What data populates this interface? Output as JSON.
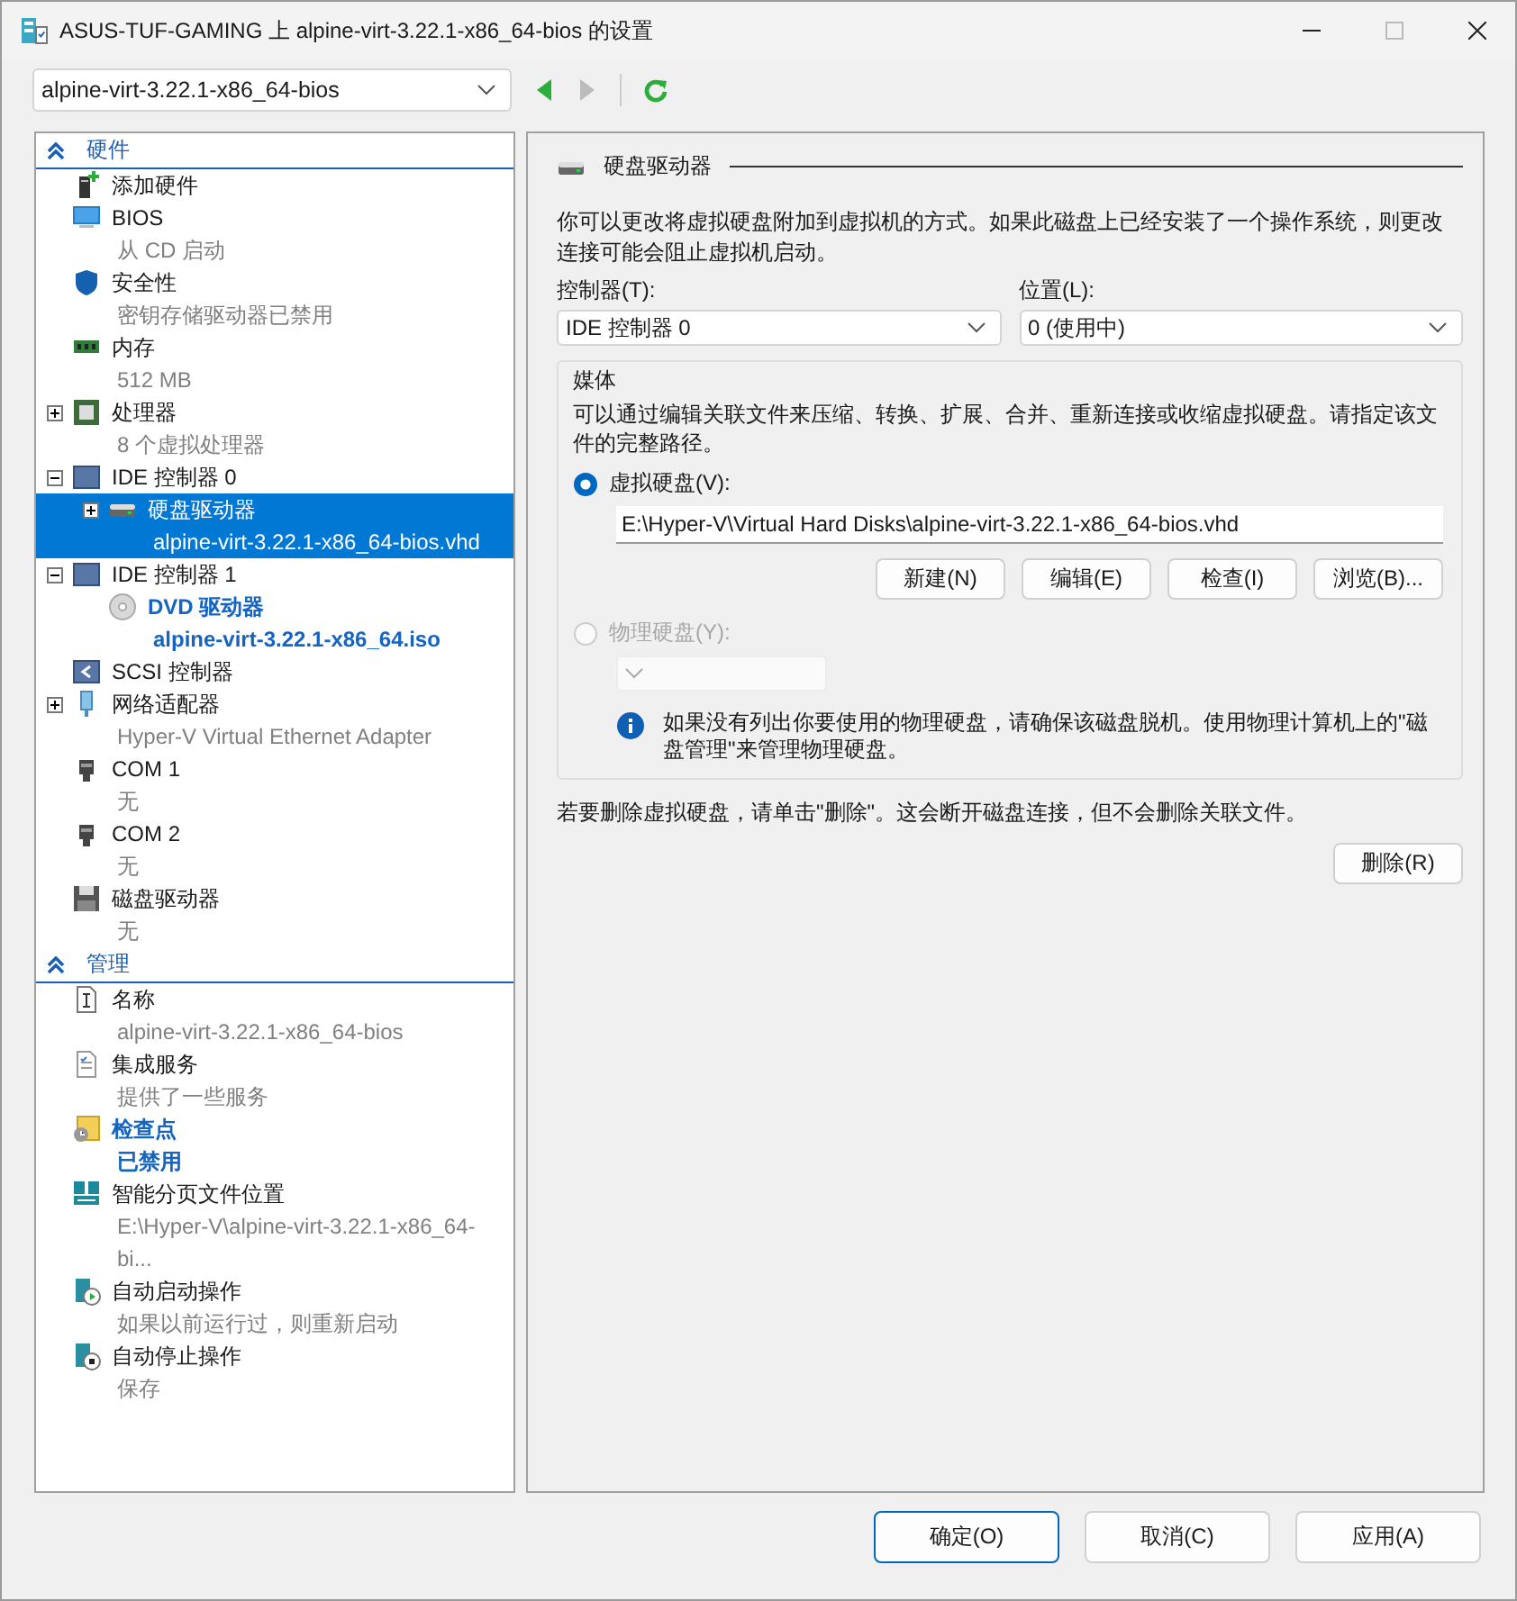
{
  "window": {
    "title": "ASUS-TUF-GAMING 上 alpine-virt-3.22.1-x86_64-bios 的设置"
  },
  "toolbar": {
    "vm_select": "alpine-virt-3.22.1-x86_64-bios",
    "back": {
      "disabled": false
    },
    "forward": {
      "disabled": true
    }
  },
  "sidebar": {
    "sections": [
      {
        "title": "硬件",
        "expanded": true,
        "items": [
          {
            "kind": "add",
            "title": "添加硬件",
            "selected": false,
            "emphasized": false
          },
          {
            "kind": "bios",
            "title": "BIOS",
            "subtitle": "从 CD 启动",
            "selected": false,
            "emphasized": false
          },
          {
            "kind": "security",
            "title": "安全性",
            "subtitle": "密钥存储驱动器已禁用",
            "selected": false,
            "emphasized": false
          },
          {
            "kind": "memory",
            "title": "内存",
            "subtitle": "512 MB",
            "selected": false,
            "emphasized": false
          },
          {
            "kind": "processor",
            "title": "处理器",
            "subtitle": "8 个虚拟处理器",
            "selected": false,
            "emphasized": false,
            "expanded": false
          },
          {
            "kind": "ide",
            "title": "IDE 控制器 0",
            "selected": false,
            "emphasized": false,
            "expanded": true,
            "children": [
              {
                "kind": "disk",
                "title": "硬盘驱动器",
                "subtitle": "alpine-virt-3.22.1-x86_64-bios.vhd",
                "selected": true,
                "emphasized": false,
                "expanded": false
              }
            ]
          },
          {
            "kind": "ide",
            "title": "IDE 控制器 1",
            "selected": false,
            "emphasized": false,
            "expanded": true,
            "children": [
              {
                "kind": "dvd",
                "title": "DVD 驱动器",
                "subtitle": "alpine-virt-3.22.1-x86_64.iso",
                "selected": false,
                "emphasized": true
              }
            ]
          },
          {
            "kind": "scsi",
            "title": "SCSI 控制器",
            "selected": false,
            "emphasized": false
          },
          {
            "kind": "network",
            "title": "网络适配器",
            "subtitle": "Hyper-V Virtual Ethernet Adapter",
            "selected": false,
            "emphasized": false,
            "expanded": false
          },
          {
            "kind": "com",
            "title": "COM 1",
            "subtitle": "无",
            "selected": false,
            "emphasized": false
          },
          {
            "kind": "com",
            "title": "COM 2",
            "subtitle": "无",
            "selected": false,
            "emphasized": false
          },
          {
            "kind": "floppy",
            "title": "磁盘驱动器",
            "subtitle": "无",
            "selected": false,
            "emphasized": false
          }
        ]
      },
      {
        "title": "管理",
        "expanded": true,
        "items": [
          {
            "kind": "name",
            "title": "名称",
            "subtitle": "alpine-virt-3.22.1-x86_64-bios",
            "selected": false,
            "emphasized": false
          },
          {
            "kind": "services",
            "title": "集成服务",
            "subtitle": "提供了一些服务",
            "selected": false,
            "emphasized": false
          },
          {
            "kind": "checkpoint",
            "title": "检查点",
            "subtitle": "已禁用",
            "selected": false,
            "emphasized": true
          },
          {
            "kind": "paging",
            "title": "智能分页文件位置",
            "subtitle": "E:\\Hyper-V\\alpine-virt-3.22.1-x86_64-bi...",
            "selected": false,
            "emphasized": false
          },
          {
            "kind": "autostart",
            "title": "自动启动操作",
            "subtitle": "如果以前运行过，则重新启动",
            "selected": false,
            "emphasized": false
          },
          {
            "kind": "autostop",
            "title": "自动停止操作",
            "subtitle": "保存",
            "selected": false,
            "emphasized": false
          }
        ]
      }
    ]
  },
  "panel": {
    "title": "硬盘驱动器",
    "description": "你可以更改将虚拟硬盘附加到虚拟机的方式。如果此磁盘上已经安装了一个操作系统，则更改连接可能会阻止虚拟机启动。",
    "controller": {
      "label": "控制器(T):",
      "value": "IDE 控制器 0"
    },
    "location": {
      "label": "位置(L):",
      "value": "0 (使用中)"
    },
    "media": {
      "title": "媒体",
      "description": "可以通过编辑关联文件来压缩、转换、扩展、合并、重新连接或收缩虚拟硬盘。请指定该文件的完整路径。",
      "virtual": {
        "label": "虚拟硬盘(V):",
        "selected": true,
        "disabled": false,
        "path": "E:\\Hyper-V\\Virtual Hard Disks\\alpine-virt-3.22.1-x86_64-bios.vhd",
        "buttons": [
          "新建(N)",
          "编辑(E)",
          "检查(I)",
          "浏览(B)..."
        ]
      },
      "physical": {
        "label": "物理硬盘(Y):",
        "selected": false,
        "disabled": true
      },
      "info": "如果没有列出你要使用的物理硬盘，请确保该磁盘脱机。使用物理计算机上的\"磁盘管理\"来管理物理硬盘。"
    },
    "delete_note": "若要删除虚拟硬盘，请单击\"删除\"。这会断开磁盘连接，但不会删除关联文件。",
    "delete_button": "删除(R)"
  },
  "footer": {
    "buttons": [
      {
        "label": "确定(O)",
        "default": true
      },
      {
        "label": "取消(C)",
        "default": false
      },
      {
        "label": "应用(A)",
        "default": false
      }
    ]
  }
}
